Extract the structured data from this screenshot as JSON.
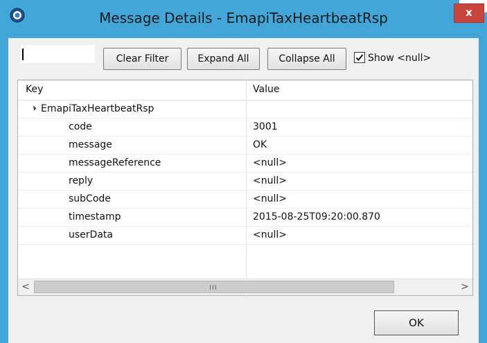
{
  "window": {
    "title": "Message Details - EmapiTaxHeartbeatRsp",
    "close_label": "x"
  },
  "toolbar": {
    "filter_value": "",
    "clear_filter": "Clear Filter",
    "expand_all": "Expand All",
    "collapse_all": "Collapse All",
    "show_null_label": "Show <null>",
    "show_null_checked": true
  },
  "table": {
    "columns": {
      "key": "Key",
      "value": "Value"
    },
    "root": {
      "key": "EmapiTaxHeartbeatRsp",
      "value": ""
    },
    "rows": [
      {
        "key": "code",
        "value": "3001"
      },
      {
        "key": "message",
        "value": "OK"
      },
      {
        "key": "messageReference",
        "value": "<null>"
      },
      {
        "key": "reply",
        "value": "<null>"
      },
      {
        "key": "subCode",
        "value": "<null>"
      },
      {
        "key": "timestamp",
        "value": "2015-08-25T09:20:00.870"
      },
      {
        "key": "userData",
        "value": "<null>"
      }
    ]
  },
  "scrollbar": {
    "left_arrow": "<",
    "right_arrow": ">",
    "grip": "III"
  },
  "footer": {
    "ok_label": "OK"
  }
}
